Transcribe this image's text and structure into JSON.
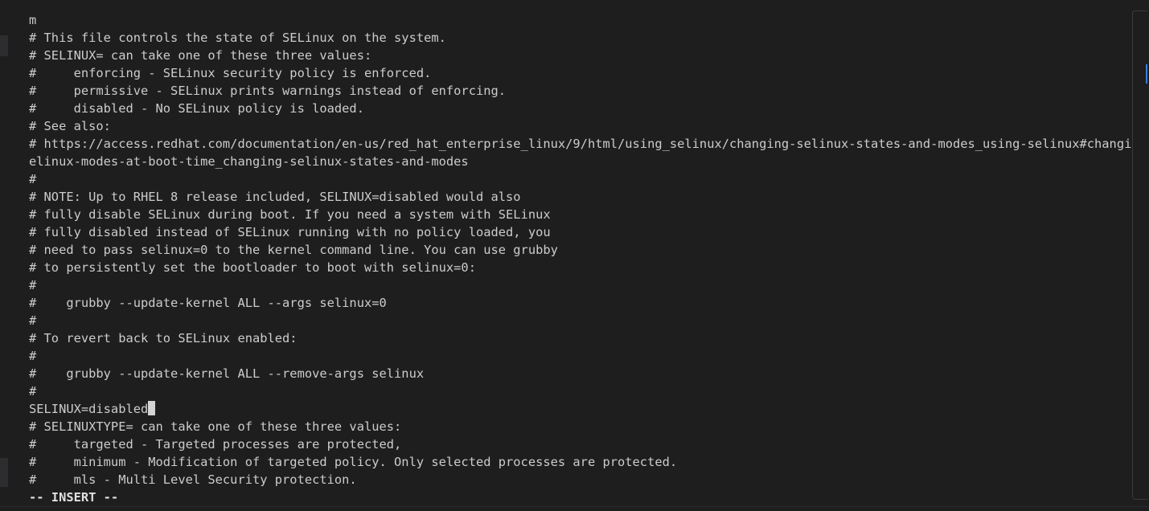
{
  "editor": {
    "lines": [
      "m",
      "# This file controls the state of SELinux on the system.",
      "# SELINUX= can take one of these three values:",
      "#     enforcing - SELinux security policy is enforced.",
      "#     permissive - SELinux prints warnings instead of enforcing.",
      "#     disabled - No SELinux policy is loaded.",
      "# See also:",
      "# https://access.redhat.com/documentation/en-us/red_hat_enterprise_linux/9/html/using_selinux/changing-selinux-states-and-modes_using-selinux#changing-s",
      "elinux-modes-at-boot-time_changing-selinux-states-and-modes",
      "#",
      "# NOTE: Up to RHEL 8 release included, SELINUX=disabled would also",
      "# fully disable SELinux during boot. If you need a system with SELinux",
      "# fully disabled instead of SELinux running with no policy loaded, you",
      "# need to pass selinux=0 to the kernel command line. You can use grubby",
      "# to persistently set the bootloader to boot with selinux=0:",
      "#",
      "#    grubby --update-kernel ALL --args selinux=0",
      "#",
      "# To revert back to SELinux enabled:",
      "#",
      "#    grubby --update-kernel ALL --remove-args selinux",
      "#",
      "SELINUX=disabled",
      "# SELINUXTYPE= can take one of these three values:",
      "#     targeted - Targeted processes are protected,",
      "#     minimum - Modification of targeted policy. Only selected processes are protected.",
      "#     mls - Multi Level Security protection."
    ],
    "mode": "-- INSERT --"
  },
  "colors": {
    "background": "#1e1e1e",
    "text": "#cccccc",
    "cursor": "#d4d4d4",
    "scroll_marker": "#3b7dd8"
  }
}
